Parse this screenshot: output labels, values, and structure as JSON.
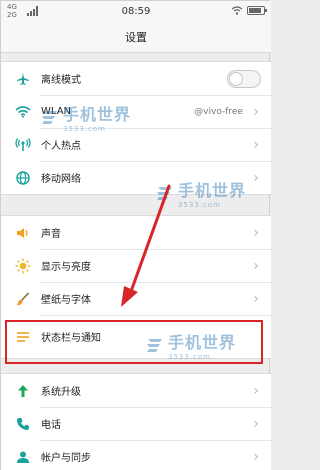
{
  "status_bar": {
    "network_top": "4G",
    "network_bottom": "2G",
    "time": "08:59"
  },
  "title": "设置",
  "groups": [
    {
      "items": [
        {
          "label": "离线模式",
          "type": "toggle",
          "icon": "airplane-icon",
          "toggle_on": false
        },
        {
          "label": "WLAN",
          "type": "value",
          "value": "@vivo-free",
          "icon": "wifi-icon"
        },
        {
          "label": "个人热点",
          "type": "chevron",
          "icon": "hotspot-icon"
        },
        {
          "label": "移动网络",
          "type": "chevron",
          "icon": "globe-icon"
        }
      ]
    },
    {
      "items": [
        {
          "label": "声音",
          "type": "chevron",
          "icon": "speaker-icon"
        },
        {
          "label": "显示与亮度",
          "type": "chevron",
          "icon": "brightness-icon"
        },
        {
          "label": "壁纸与字体",
          "type": "chevron",
          "icon": "brush-icon"
        },
        {
          "label": "状态栏与通知",
          "type": "chevron",
          "icon": "notification-lines-icon"
        }
      ]
    },
    {
      "items": [
        {
          "label": "系统升级",
          "type": "chevron",
          "icon": "upgrade-arrow-icon"
        },
        {
          "label": "电话",
          "type": "chevron",
          "icon": "phone-icon"
        },
        {
          "label": "帐户与同步",
          "type": "chevron",
          "icon": "account-sync-icon"
        }
      ]
    }
  ],
  "watermark": {
    "text": "手机世界",
    "sub": "3533.com"
  },
  "colors": {
    "accent_teal": "#1aa39a",
    "highlight_red": "#d7262a",
    "arrow_red": "#d7262a",
    "sound_orange": "#f0a020",
    "brightness_yellow": "#f3b52b",
    "brush_orange": "#e9962b",
    "notif_orange": "#f0a020",
    "upgrade_green": "#21a35a"
  }
}
